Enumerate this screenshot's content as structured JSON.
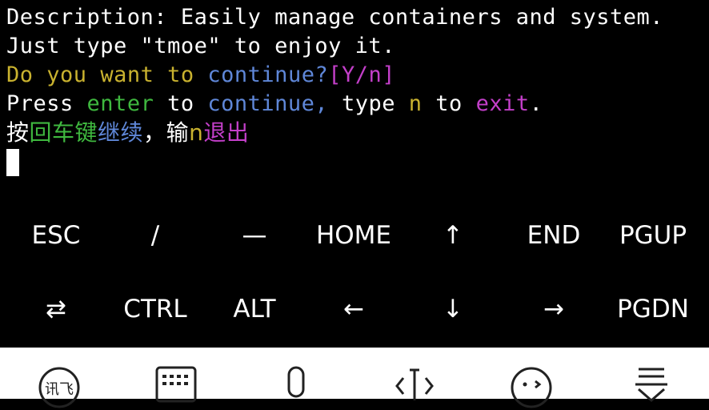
{
  "terminal": {
    "line1": "Description: Easily manage containers and system.",
    "line2": "Just type \"tmoe\" to enjoy it.",
    "line3": {
      "do": "Do",
      "you": "you",
      "want": "want",
      "to": "to",
      "continue": "continue?",
      "yn": "[Y/n]"
    },
    "line4": {
      "press": "Press",
      "enter": "enter",
      "to": "to",
      "continue": "continue,",
      "type": "type",
      "n": "n",
      "to2": "to",
      "exit": "exit",
      "period": "."
    },
    "line5": {
      "press": "按",
      "enter": "回车键",
      "continue": "继续",
      "comma": "，",
      "input": "输",
      "n": "n",
      "exit": "退出"
    }
  },
  "extra_keys": {
    "row1": [
      "ESC",
      "/",
      "—",
      "HOME",
      "↑",
      "END",
      "PGUP"
    ],
    "row2": [
      "⇄",
      "CTRL",
      "ALT",
      "←",
      "↓",
      "→",
      "PGDN"
    ]
  },
  "colors": {
    "yellow": "#c9b22f",
    "blue": "#5f87d8",
    "magenta": "#c33fc9",
    "green": "#3fb83f",
    "text": "#ffffff",
    "background": "#000000"
  },
  "ime_bar": {
    "icons": [
      "ifly-logo-icon",
      "keyboard-icon",
      "microphone-icon",
      "cursor-move-icon",
      "emoji-icon",
      "collapse-keyboard-icon"
    ],
    "logo_text": "讯飞"
  }
}
